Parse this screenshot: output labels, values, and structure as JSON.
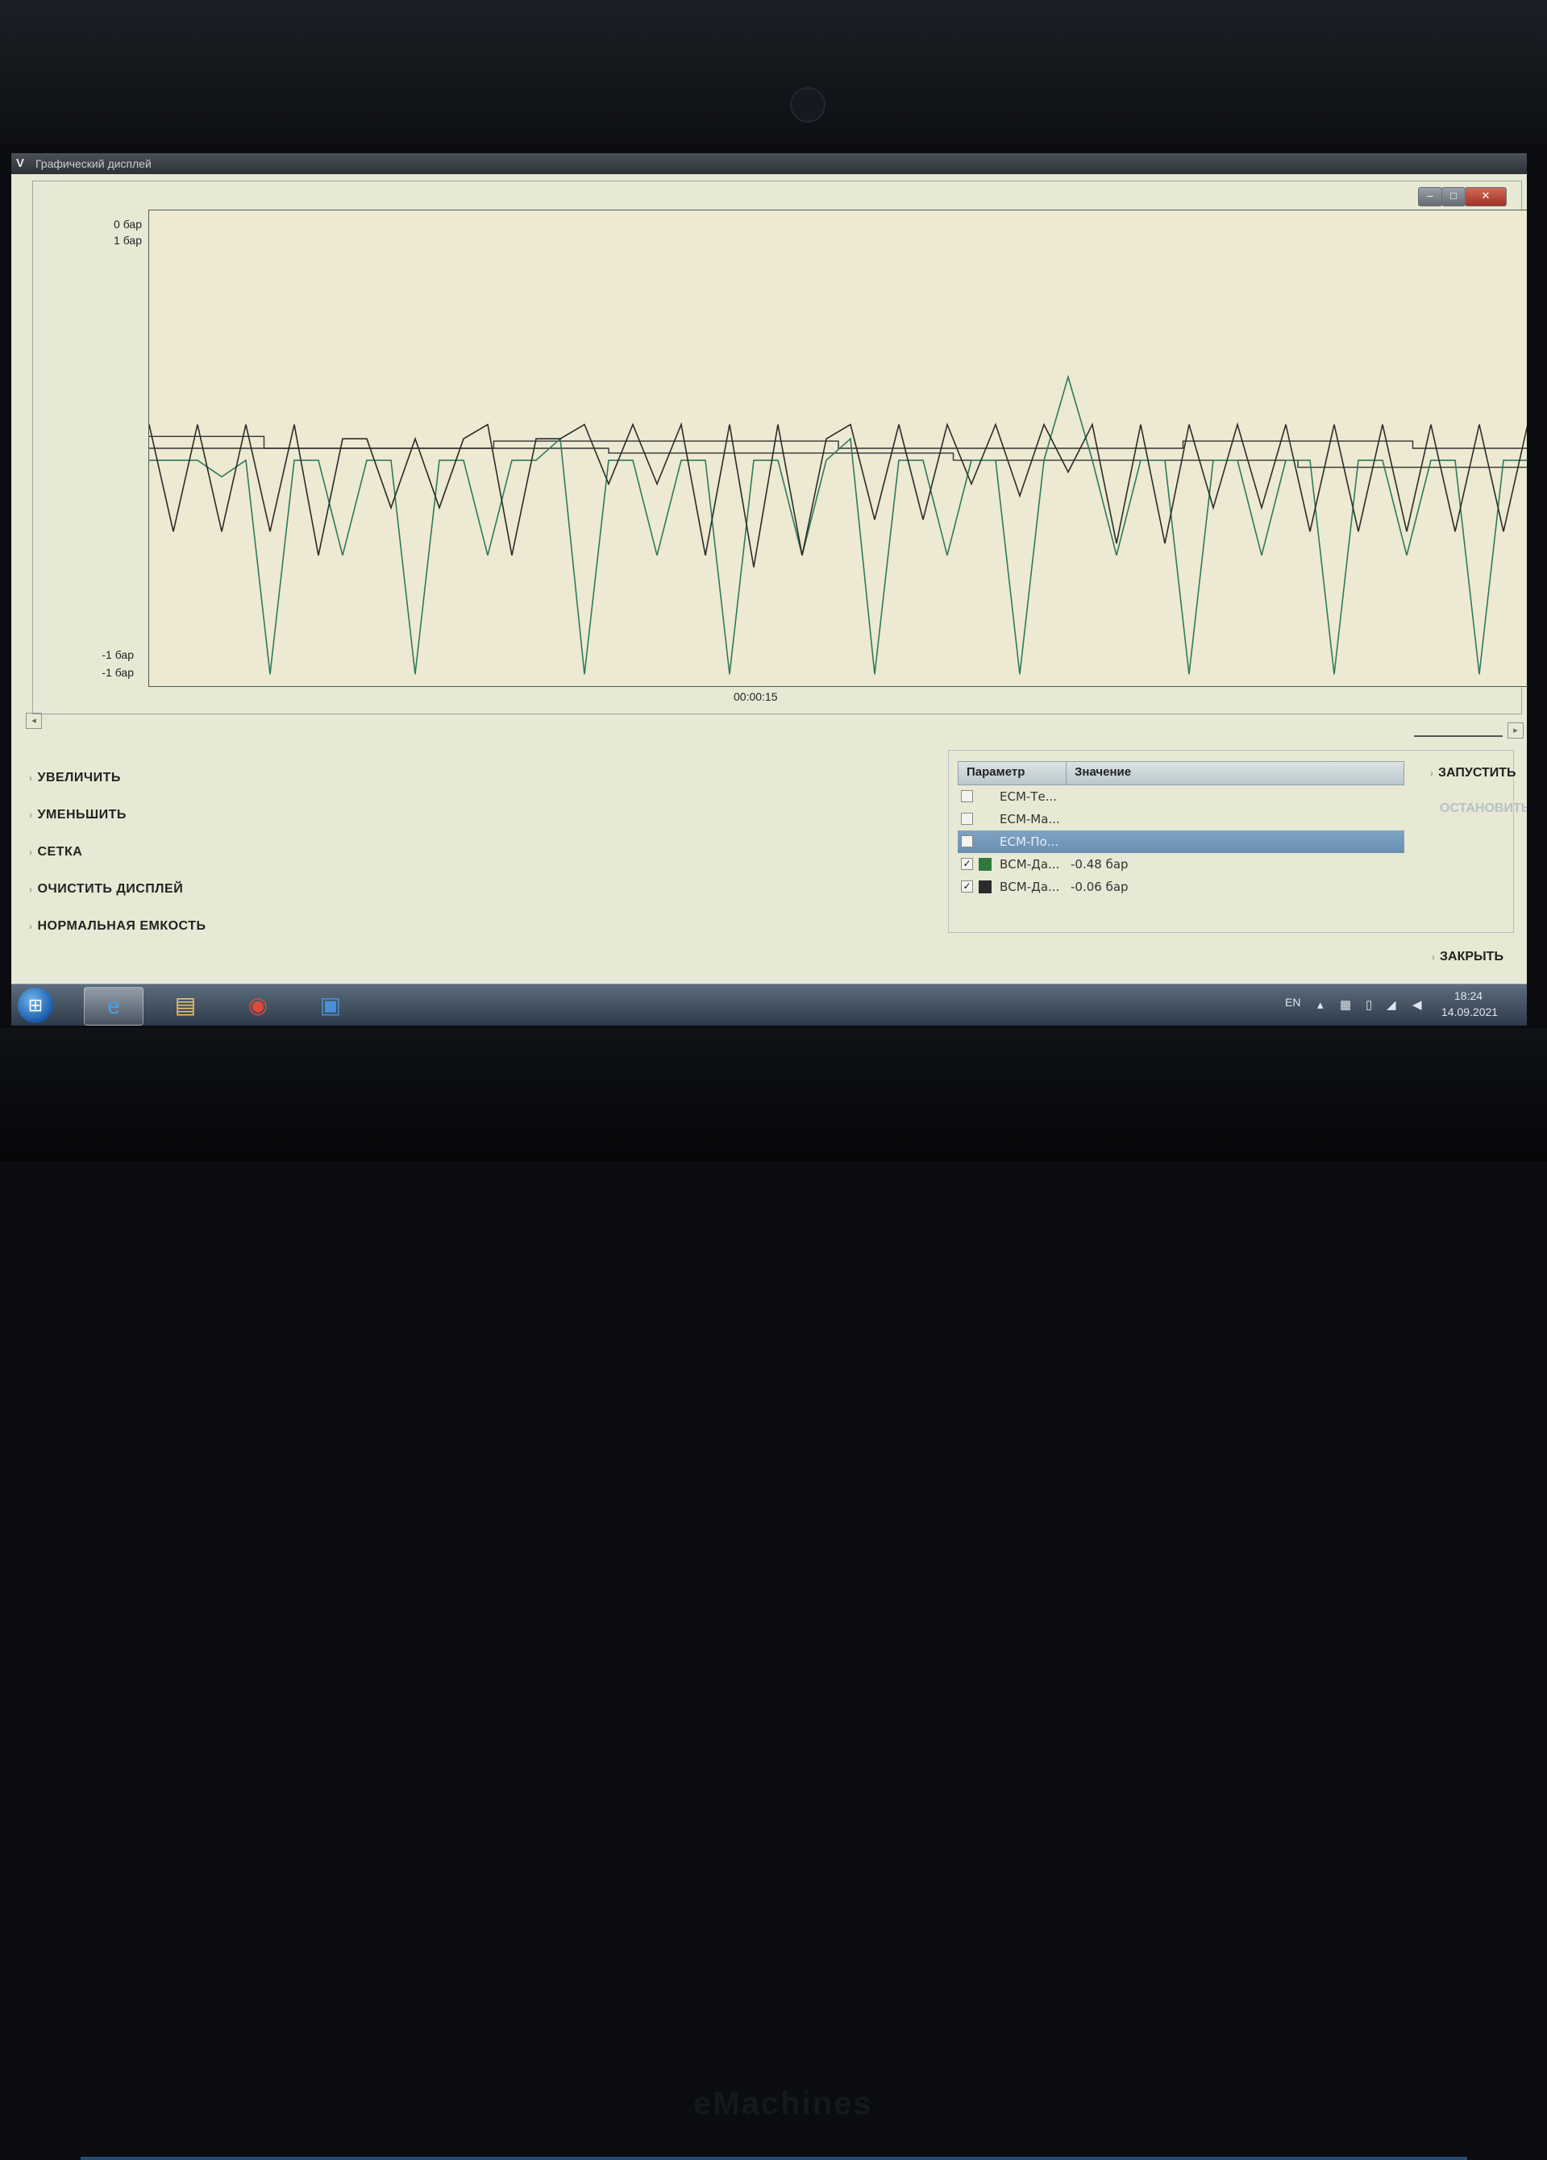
{
  "window": {
    "title": "Графический дисплей",
    "controls": {
      "minimize": "–",
      "maximize": "□",
      "close": "✕"
    }
  },
  "chart_data": {
    "type": "line",
    "title": "",
    "xlabel": "00:00:15",
    "y_tick_labels_top": [
      "0 бар",
      "1 бар"
    ],
    "y_tick_labels_bottom": [
      "-1 бар",
      "-1 бар"
    ],
    "ylim": [
      -1,
      1
    ],
    "grid": false,
    "series": [
      {
        "name": "ВСМ-Да...",
        "color": "#2e7a5c",
        "values": [
          -0.05,
          -0.05,
          -0.05,
          -0.12,
          -0.05,
          -0.95,
          -0.05,
          -0.05,
          -0.45,
          -0.05,
          -0.05,
          -0.95,
          -0.05,
          -0.05,
          -0.45,
          -0.05,
          -0.05,
          0.04,
          -0.95,
          -0.05,
          -0.05,
          -0.45,
          -0.05,
          -0.05,
          -0.95,
          -0.05,
          -0.05,
          -0.45,
          -0.05,
          0.04,
          -0.95,
          -0.05,
          -0.05,
          -0.45,
          -0.05,
          -0.05,
          -0.95,
          -0.05,
          0.3,
          -0.05,
          -0.45,
          -0.05,
          -0.05,
          -0.95,
          -0.05,
          -0.05,
          -0.45,
          -0.05,
          -0.05,
          -0.95,
          -0.05,
          -0.05,
          -0.45,
          -0.05,
          -0.05,
          -0.95,
          -0.05,
          -0.05
        ]
      },
      {
        "name": "ВСМ-Да...",
        "color": "#2b2b2b",
        "values": [
          0.1,
          -0.35,
          0.1,
          -0.35,
          0.1,
          -0.35,
          0.1,
          -0.45,
          0.04,
          0.04,
          -0.25,
          0.04,
          -0.25,
          0.04,
          0.1,
          -0.45,
          0.04,
          0.04,
          0.1,
          -0.15,
          0.1,
          -0.15,
          0.1,
          -0.45,
          0.1,
          -0.5,
          0.1,
          -0.45,
          0.04,
          0.1,
          -0.3,
          0.1,
          -0.3,
          0.1,
          -0.15,
          0.1,
          -0.2,
          0.1,
          -0.1,
          0.1,
          -0.4,
          0.1,
          -0.4,
          0.1,
          -0.25,
          0.1,
          -0.25,
          0.1,
          -0.35,
          0.1,
          -0.35,
          0.1,
          -0.35,
          0.1,
          -0.35,
          0.1,
          -0.35,
          0.1
        ]
      }
    ],
    "step_baselines": [
      {
        "values": [
          0.05,
          0.0,
          0.0,
          0.03,
          0.03,
          0.03,
          0.0,
          0.0,
          0.0,
          0.03,
          0.03,
          0.0
        ]
      },
      {
        "values": [
          0.0,
          0.0,
          0.0,
          0.0,
          -0.02,
          -0.02,
          -0.02,
          -0.05,
          -0.05,
          -0.05,
          -0.08,
          -0.08
        ]
      }
    ]
  },
  "commands": [
    {
      "label": "УВЕЛИЧИТЬ"
    },
    {
      "label": "УМЕНЬШИТЬ"
    },
    {
      "label": "СЕТКА"
    },
    {
      "label": "ОЧИСТИТЬ ДИСПЛЕЙ"
    },
    {
      "label": "НОРМАЛЬНАЯ ЕМКОСТЬ"
    }
  ],
  "params": {
    "header_param": "Параметр",
    "header_value": "Значение",
    "rows": [
      {
        "name": "ECM-Те...",
        "value": "",
        "checked": false,
        "color": "",
        "selected": false
      },
      {
        "name": "ECM-Ма...",
        "value": "",
        "checked": false,
        "color": "",
        "selected": false
      },
      {
        "name": "ECM-По...",
        "value": "",
        "checked": false,
        "color": "",
        "selected": true
      },
      {
        "name": "ВСМ-Да...",
        "value": "-0.48 бар",
        "checked": true,
        "color": "#2e7a3c",
        "selected": false
      },
      {
        "name": "ВСМ-Да...",
        "value": "-0.06 бар",
        "checked": true,
        "color": "#2b2b2b",
        "selected": false
      }
    ]
  },
  "actions": {
    "start": "ЗАПУСТИТЬ",
    "stop": "ОСТАНОВИТЬ",
    "close": "ЗАКРЫТЬ"
  },
  "taskbar": {
    "lang": "EN",
    "time": "18:24",
    "date": "14.09.2021",
    "apps": [
      "start-orb",
      "internet-explorer-icon",
      "file-explorer-icon",
      "chrome-icon",
      "save-disk-icon"
    ]
  }
}
